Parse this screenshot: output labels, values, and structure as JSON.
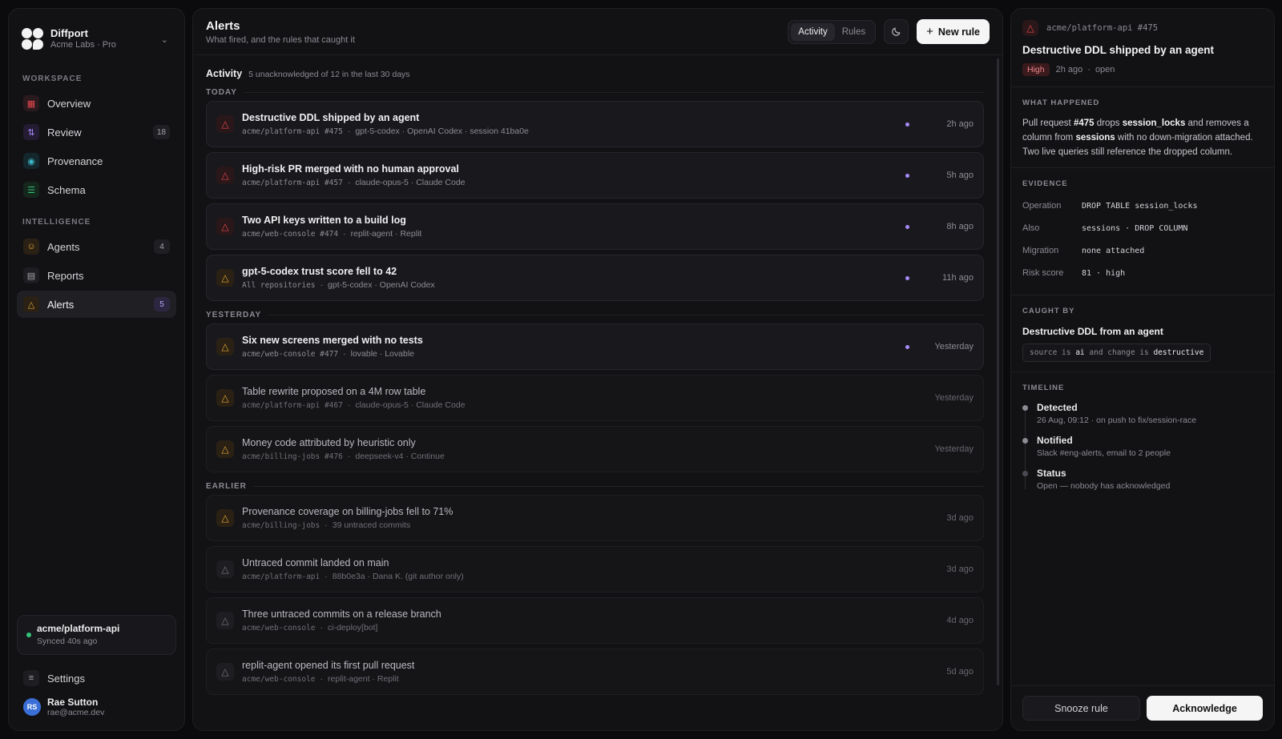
{
  "brand": {
    "name": "Diffport",
    "sub": "Acme Labs · Pro"
  },
  "sidebar": {
    "sections": [
      {
        "label": "WORKSPACE",
        "items": [
          {
            "key": "overview",
            "label": "Overview",
            "icon": "grid-icon",
            "badge": ""
          },
          {
            "key": "review",
            "label": "Review",
            "icon": "git-pull-request-icon",
            "badge": "18"
          },
          {
            "key": "provenance",
            "label": "Provenance",
            "icon": "scan-icon",
            "badge": ""
          },
          {
            "key": "schema",
            "label": "Schema",
            "icon": "database-icon",
            "badge": ""
          }
        ]
      },
      {
        "label": "INTELLIGENCE",
        "items": [
          {
            "key": "agents",
            "label": "Agents",
            "icon": "robot-icon",
            "badge": "4"
          },
          {
            "key": "reports",
            "label": "Reports",
            "icon": "document-icon",
            "badge": ""
          },
          {
            "key": "alerts",
            "label": "Alerts",
            "icon": "warning-icon",
            "badge": "5"
          }
        ]
      }
    ],
    "repo": {
      "name": "acme/platform-api",
      "status": "Synced 40s ago"
    },
    "settings_label": "Settings",
    "user": {
      "initials": "RS",
      "name": "Rae Sutton",
      "email": "rae@acme.dev"
    }
  },
  "header": {
    "title": "Alerts",
    "subtitle": "What fired, and the rules that caught it",
    "tabs": [
      "Activity",
      "Rules"
    ],
    "active_tab": "Activity",
    "new_rule_label": "New rule"
  },
  "feed": {
    "title": "Activity",
    "count": "5 unacknowledged of 12 in the last 30 days",
    "groups": [
      {
        "label": "TODAY",
        "alerts": [
          {
            "title": "Destructive DDL shipped by an agent",
            "repo": "acme/platform-api #475",
            "meta": "gpt-5-codex · OpenAI Codex · session 41ba0e",
            "time": "2h ago",
            "severity": "red",
            "unread": true
          },
          {
            "title": "High-risk PR merged with no human approval",
            "repo": "acme/platform-api #457",
            "meta": "claude-opus-5 · Claude Code",
            "time": "5h ago",
            "severity": "red",
            "unread": true
          },
          {
            "title": "Two API keys written to a build log",
            "repo": "acme/web-console #474",
            "meta": "replit-agent · Replit",
            "time": "8h ago",
            "severity": "red",
            "unread": true
          },
          {
            "title": "gpt-5-codex trust score fell to 42",
            "repo": "All repositories",
            "meta": "gpt-5-codex · OpenAI Codex",
            "time": "11h ago",
            "severity": "amber",
            "unread": true
          }
        ]
      },
      {
        "label": "YESTERDAY",
        "alerts": [
          {
            "title": "Six new screens merged with no tests",
            "repo": "acme/web-console #477",
            "meta": "lovable · Lovable",
            "time": "Yesterday",
            "severity": "amber",
            "unread": true
          },
          {
            "title": "Table rewrite proposed on a 4M row table",
            "repo": "acme/platform-api #467",
            "meta": "claude-opus-5 · Claude Code",
            "time": "Yesterday",
            "severity": "amber",
            "unread": false
          },
          {
            "title": "Money code attributed by heuristic only",
            "repo": "acme/billing-jobs #476",
            "meta": "deepseek-v4 · Continue",
            "time": "Yesterday",
            "severity": "amber",
            "unread": false
          }
        ]
      },
      {
        "label": "EARLIER",
        "alerts": [
          {
            "title": "Provenance coverage on billing-jobs fell to 71%",
            "repo": "acme/billing-jobs",
            "meta": "39 untraced commits",
            "time": "3d ago",
            "severity": "amber",
            "unread": false
          },
          {
            "title": "Untraced commit landed on main",
            "repo": "acme/platform-api",
            "meta": "88b0e3a · Dana K. (git author only)",
            "time": "3d ago",
            "severity": "grey",
            "unread": false
          },
          {
            "title": "Three untraced commits on a release branch",
            "repo": "acme/web-console",
            "meta": "ci-deploy[bot]",
            "time": "4d ago",
            "severity": "grey",
            "unread": false
          },
          {
            "title": "replit-agent opened its first pull request",
            "repo": "acme/web-console",
            "meta": "replit-agent · Replit",
            "time": "5d ago",
            "severity": "grey",
            "unread": false
          }
        ]
      }
    ]
  },
  "detail": {
    "ref": "acme/platform-api #475",
    "title": "Destructive DDL shipped by an agent",
    "severity": "High",
    "age": "2h ago",
    "state": "open",
    "what_label": "WHAT HAPPENED",
    "what": {
      "t1": "Pull request ",
      "pr": "#475",
      "t2": " drops ",
      "table": "session_locks",
      "t3": " and removes a column from ",
      "table2": "sessions",
      "t4": " with no down-migration attached. Two live queries still reference the dropped column."
    },
    "evidence_label": "EVIDENCE",
    "evidence": [
      {
        "key": "Operation",
        "value": "DROP TABLE session_locks"
      },
      {
        "key": "Also",
        "value": "sessions · DROP COLUMN"
      },
      {
        "key": "Migration",
        "value": "none attached"
      },
      {
        "key": "Risk score",
        "value": "81 · high"
      }
    ],
    "caught_label": "CAUGHT BY",
    "rule_name": "Destructive DDL from an agent",
    "rule_expr": {
      "p1": "source is ",
      "v1": "ai",
      "p2": " and change is ",
      "v2": "destructive"
    },
    "timeline_label": "TIMELINE",
    "timeline": [
      {
        "title": "Detected",
        "sub": "26 Aug, 09:12 · on push to fix/session-race"
      },
      {
        "title": "Notified",
        "sub": "Slack #eng-alerts, email to 2 people"
      },
      {
        "title": "Status",
        "sub": "Open — nobody has acknowledged"
      }
    ],
    "snooze_label": "Snooze rule",
    "ack_label": "Acknowledge"
  },
  "colors": {
    "accent": "#a78bfa",
    "danger": "#e5484d",
    "warning": "#e2a336",
    "success": "#33c27a"
  }
}
